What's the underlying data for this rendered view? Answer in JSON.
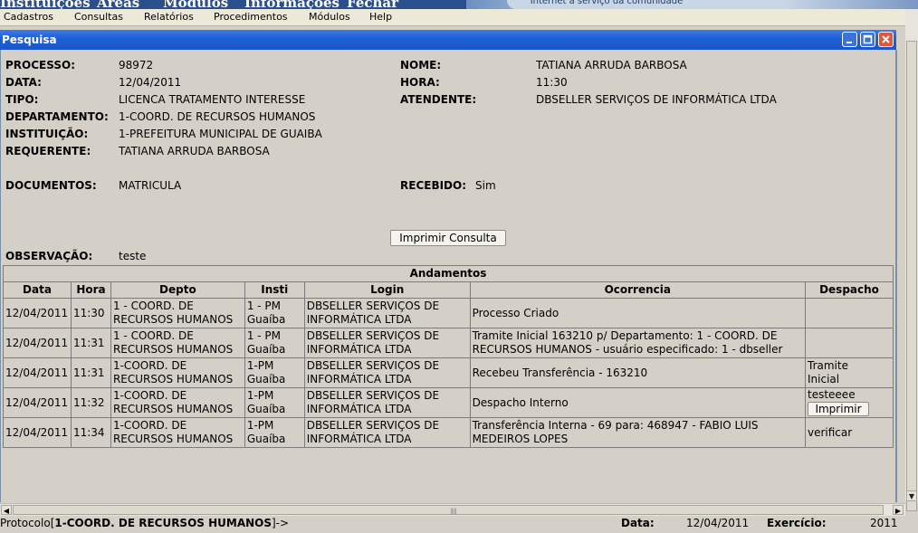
{
  "top_nav": {
    "items": [
      "Instituições",
      "Áreas",
      "Módulos",
      "Informações",
      "Fechar"
    ],
    "tagline": "Internet a serviço da comunidade"
  },
  "menubar": {
    "items": [
      "Cadastros",
      "Consultas",
      "Relatórios",
      "Procedimentos",
      "Módulos",
      "Help"
    ]
  },
  "window": {
    "title": "Pesquisa"
  },
  "fields": {
    "processo_label": "PROCESSO:",
    "processo": "98972",
    "data_label": "DATA:",
    "data": "12/04/2011",
    "tipo_label": "TIPO:",
    "tipo": "LICENCA TRATAMENTO INTERESSE",
    "departamento_label": "DEPARTAMENTO:",
    "departamento": "1-COORD. DE RECURSOS HUMANOS",
    "instituicao_label": "INSTITUIÇÃO:",
    "instituicao": "1-PREFEITURA MUNICIPAL DE GUAIBA",
    "requerente_label": "REQUERENTE:",
    "requerente": "TATIANA ARRUDA BARBOSA",
    "nome_label": "NOME:",
    "nome": "TATIANA ARRUDA BARBOSA",
    "hora_label": "HORA:",
    "hora": "11:30",
    "atendente_label": "ATENDENTE:",
    "atendente": "DBSELLER SERVIÇOS DE INFORMÁTICA LTDA",
    "documentos_label": "DOCUMENTOS:",
    "documentos": "MATRICULA",
    "recebido_label": "RECEBIDO:",
    "recebido": "Sim",
    "observacao_label": "OBSERVAÇÃO:",
    "observacao": "teste"
  },
  "buttons": {
    "imprimir_consulta": "Imprimir Consulta",
    "imprimir": "Imprimir"
  },
  "andamentos": {
    "title": "Andamentos",
    "headers": [
      "Data",
      "Hora",
      "Depto",
      "Insti",
      "Login",
      "Ocorrencia",
      "Despacho"
    ],
    "rows": [
      {
        "data": "12/04/2011",
        "hora": "11:30",
        "depto": [
          "1 - COORD. DE",
          "RECURSOS HUMANOS"
        ],
        "insti": [
          "1 - PM",
          "Guaíba"
        ],
        "login": [
          "DBSELLER SERVIÇOS DE",
          "INFORMÁTICA LTDA"
        ],
        "ocorrencia": [
          "Processo Criado"
        ],
        "despacho": []
      },
      {
        "data": "12/04/2011",
        "hora": "11:31",
        "depto": [
          "1 - COORD. DE",
          "RECURSOS HUMANOS"
        ],
        "insti": [
          "1 - PM",
          "Guaíba"
        ],
        "login": [
          "DBSELLER SERVIÇOS DE",
          "INFORMÁTICA LTDA"
        ],
        "ocorrencia": [
          "Tramite Inicial 163210 p/ Departamento: 1 - COORD. DE",
          "RECURSOS HUMANOS - usuário especificado: 1 - dbseller"
        ],
        "despacho": []
      },
      {
        "data": "12/04/2011",
        "hora": "11:31",
        "depto": [
          "1-COORD. DE",
          "RECURSOS HUMANOS"
        ],
        "insti": [
          "1-PM",
          "Guaíba"
        ],
        "login": [
          "DBSELLER SERVIÇOS DE",
          "INFORMÁTICA LTDA"
        ],
        "ocorrencia": [
          "Recebeu Transferência - 163210"
        ],
        "despacho": [
          "Tramite",
          "Inicial"
        ]
      },
      {
        "data": "12/04/2011",
        "hora": "11:32",
        "depto": [
          "1-COORD. DE",
          "RECURSOS HUMANOS"
        ],
        "insti": [
          "1-PM",
          "Guaíba"
        ],
        "login": [
          "DBSELLER SERVIÇOS DE",
          "INFORMÁTICA LTDA"
        ],
        "ocorrencia": [
          "Despacho Interno"
        ],
        "despacho": [
          "testeeee"
        ],
        "despacho_button": true
      },
      {
        "data": "12/04/2011",
        "hora": "11:34",
        "depto": [
          "1-COORD. DE",
          "RECURSOS HUMANOS"
        ],
        "insti": [
          "1-PM",
          "Guaíba"
        ],
        "login": [
          "DBSELLER SERVIÇOS DE",
          "INFORMÁTICA LTDA"
        ],
        "ocorrencia": [
          "Transferência Interna - 69 para: 468947 - FABIO LUIS",
          "MEDEIROS LOPES"
        ],
        "despacho": [
          "verificar"
        ]
      }
    ]
  },
  "status_bar": {
    "protocolo_prefix": "Protocolo[",
    "protocolo_dept": "1-COORD. DE RECURSOS HUMANOS",
    "protocolo_suffix": "]->",
    "data_label": "Data:",
    "data": "12/04/2011",
    "exercicio_label": "Exercício:",
    "exercicio": "2011"
  }
}
